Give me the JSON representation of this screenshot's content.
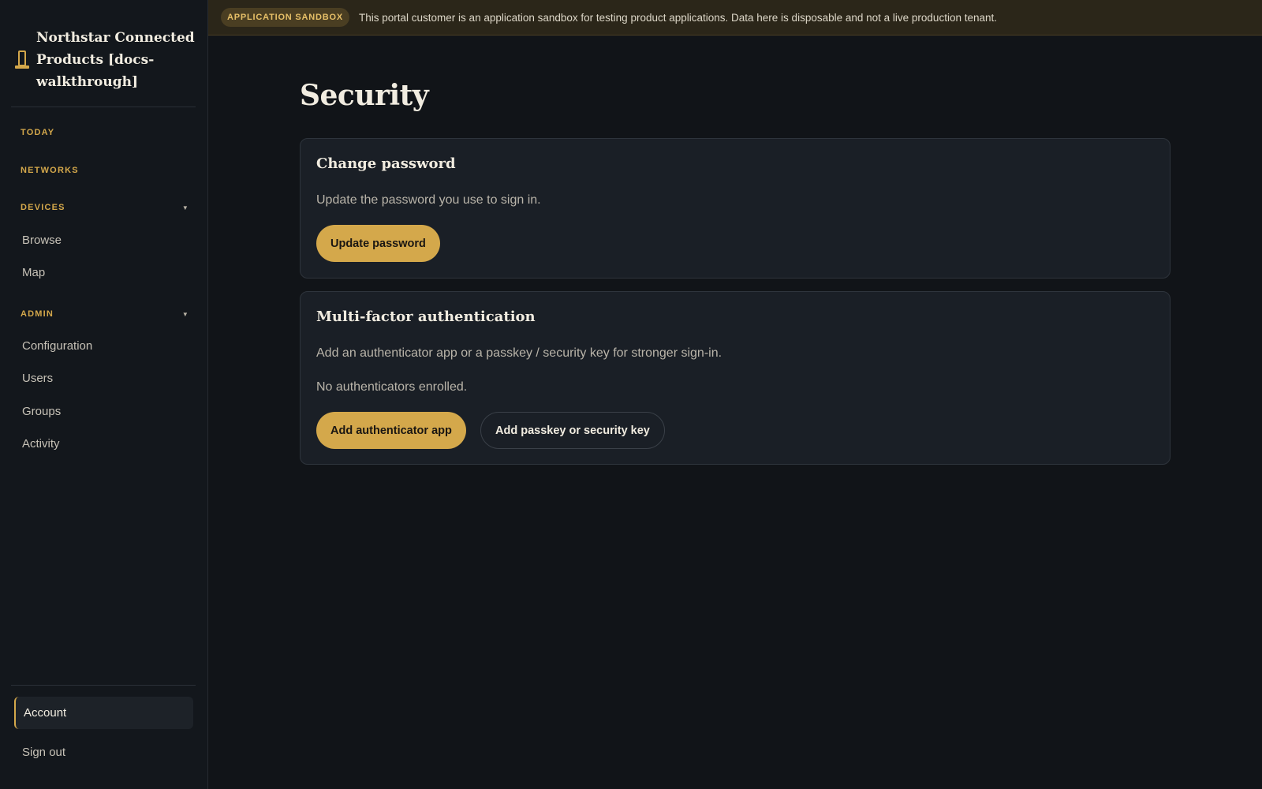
{
  "brand": {
    "title": "Northstar Connected Products [docs-walkthrough]"
  },
  "banner": {
    "badge": "APPLICATION SANDBOX",
    "text": "This portal customer is an application sandbox for testing product applications. Data here is disposable and not a live production tenant."
  },
  "sidebar": {
    "today": "TODAY",
    "networks": "NETWORKS",
    "devices": {
      "label": "DEVICES",
      "items": [
        "Browse",
        "Map"
      ]
    },
    "admin": {
      "label": "ADMIN",
      "items": [
        "Configuration",
        "Users",
        "Groups",
        "Activity"
      ]
    },
    "account": "Account",
    "signout": "Sign out"
  },
  "page": {
    "title": "Security"
  },
  "password_card": {
    "title": "Change password",
    "description": "Update the password you use to sign in.",
    "button": "Update password"
  },
  "mfa_card": {
    "title": "Multi-factor authentication",
    "description": "Add an authenticator app or a passkey / security key for stronger sign-in.",
    "status": "No authenticators enrolled.",
    "add_app_button": "Add authenticator app",
    "add_passkey_button": "Add passkey or security key"
  },
  "colors": {
    "accent": "#d4a84b",
    "background": "#111418",
    "sidebar": "#13171c",
    "card": "#1a1f26"
  },
  "icons": {
    "brand": "bollard-icon",
    "chevron": "chevron-down-icon"
  }
}
